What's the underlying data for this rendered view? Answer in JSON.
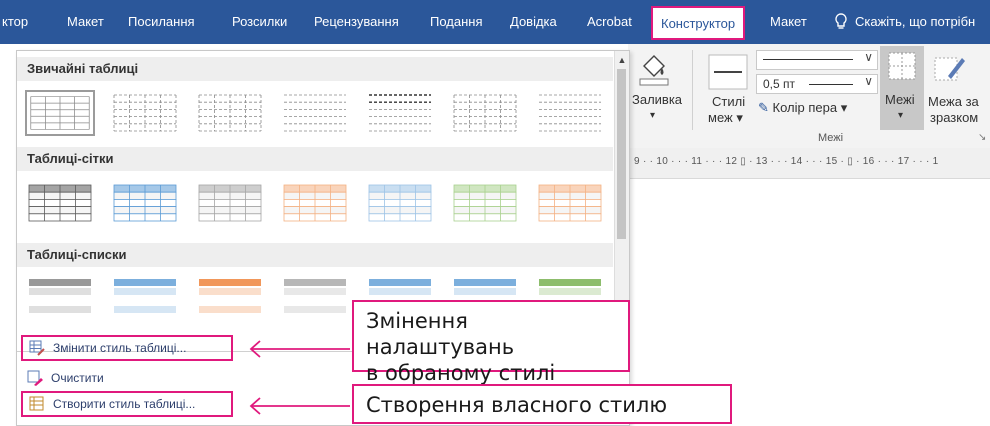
{
  "tabs": [
    "ктор",
    "Макет",
    "Посилання",
    "Розсилки",
    "Рецензування",
    "Подання",
    "Довідка",
    "Acrobat",
    "Конструктор",
    "Макет",
    "Скажіть, що потрібн"
  ],
  "ribbon": {
    "shading_label": "Заливка",
    "styles_label_1": "Стилі",
    "styles_label_2": "меж",
    "pen_weight": "0,5 пт",
    "pen_color": "Колір пера",
    "borders_label": "Межі",
    "border_painter_1": "Межа за",
    "border_painter_2": "зразком",
    "group_label": "Межі"
  },
  "ruler": "9 · · 10 · · · 11 · · · 12 ▯ · 13 · · · 14 · · · 15 · ▯ · 16 · · · 17 · · · 1",
  "gallery": {
    "sections": [
      "Звичайні таблиці",
      "Таблиці-сітки",
      "Таблиці-списки"
    ],
    "grid_colors": [
      "#5a5a5a",
      "#5b9bd5",
      "#a5a5a5",
      "#f4b183",
      "#9dc3e6",
      "#a9d18e",
      "#f4b183"
    ],
    "list_colors": [
      "#7f7f7f",
      "#5b9bd5",
      "#ed7d31",
      "#a5a5a5",
      "#5b9bd5",
      "#5b9bd5",
      "#70ad47"
    ]
  },
  "menu": {
    "modify": "Змінити стиль таблиці...",
    "clear": "Очистити",
    "new": "Створити стиль таблиці..."
  },
  "callouts": {
    "modify_line1": "Змінення налаштувань",
    "modify_line2": "в обраному стилі",
    "new": "Створення власного стилю"
  },
  "colors": {
    "accent": "#e0197d",
    "ribbon_blue": "#2b579a"
  }
}
